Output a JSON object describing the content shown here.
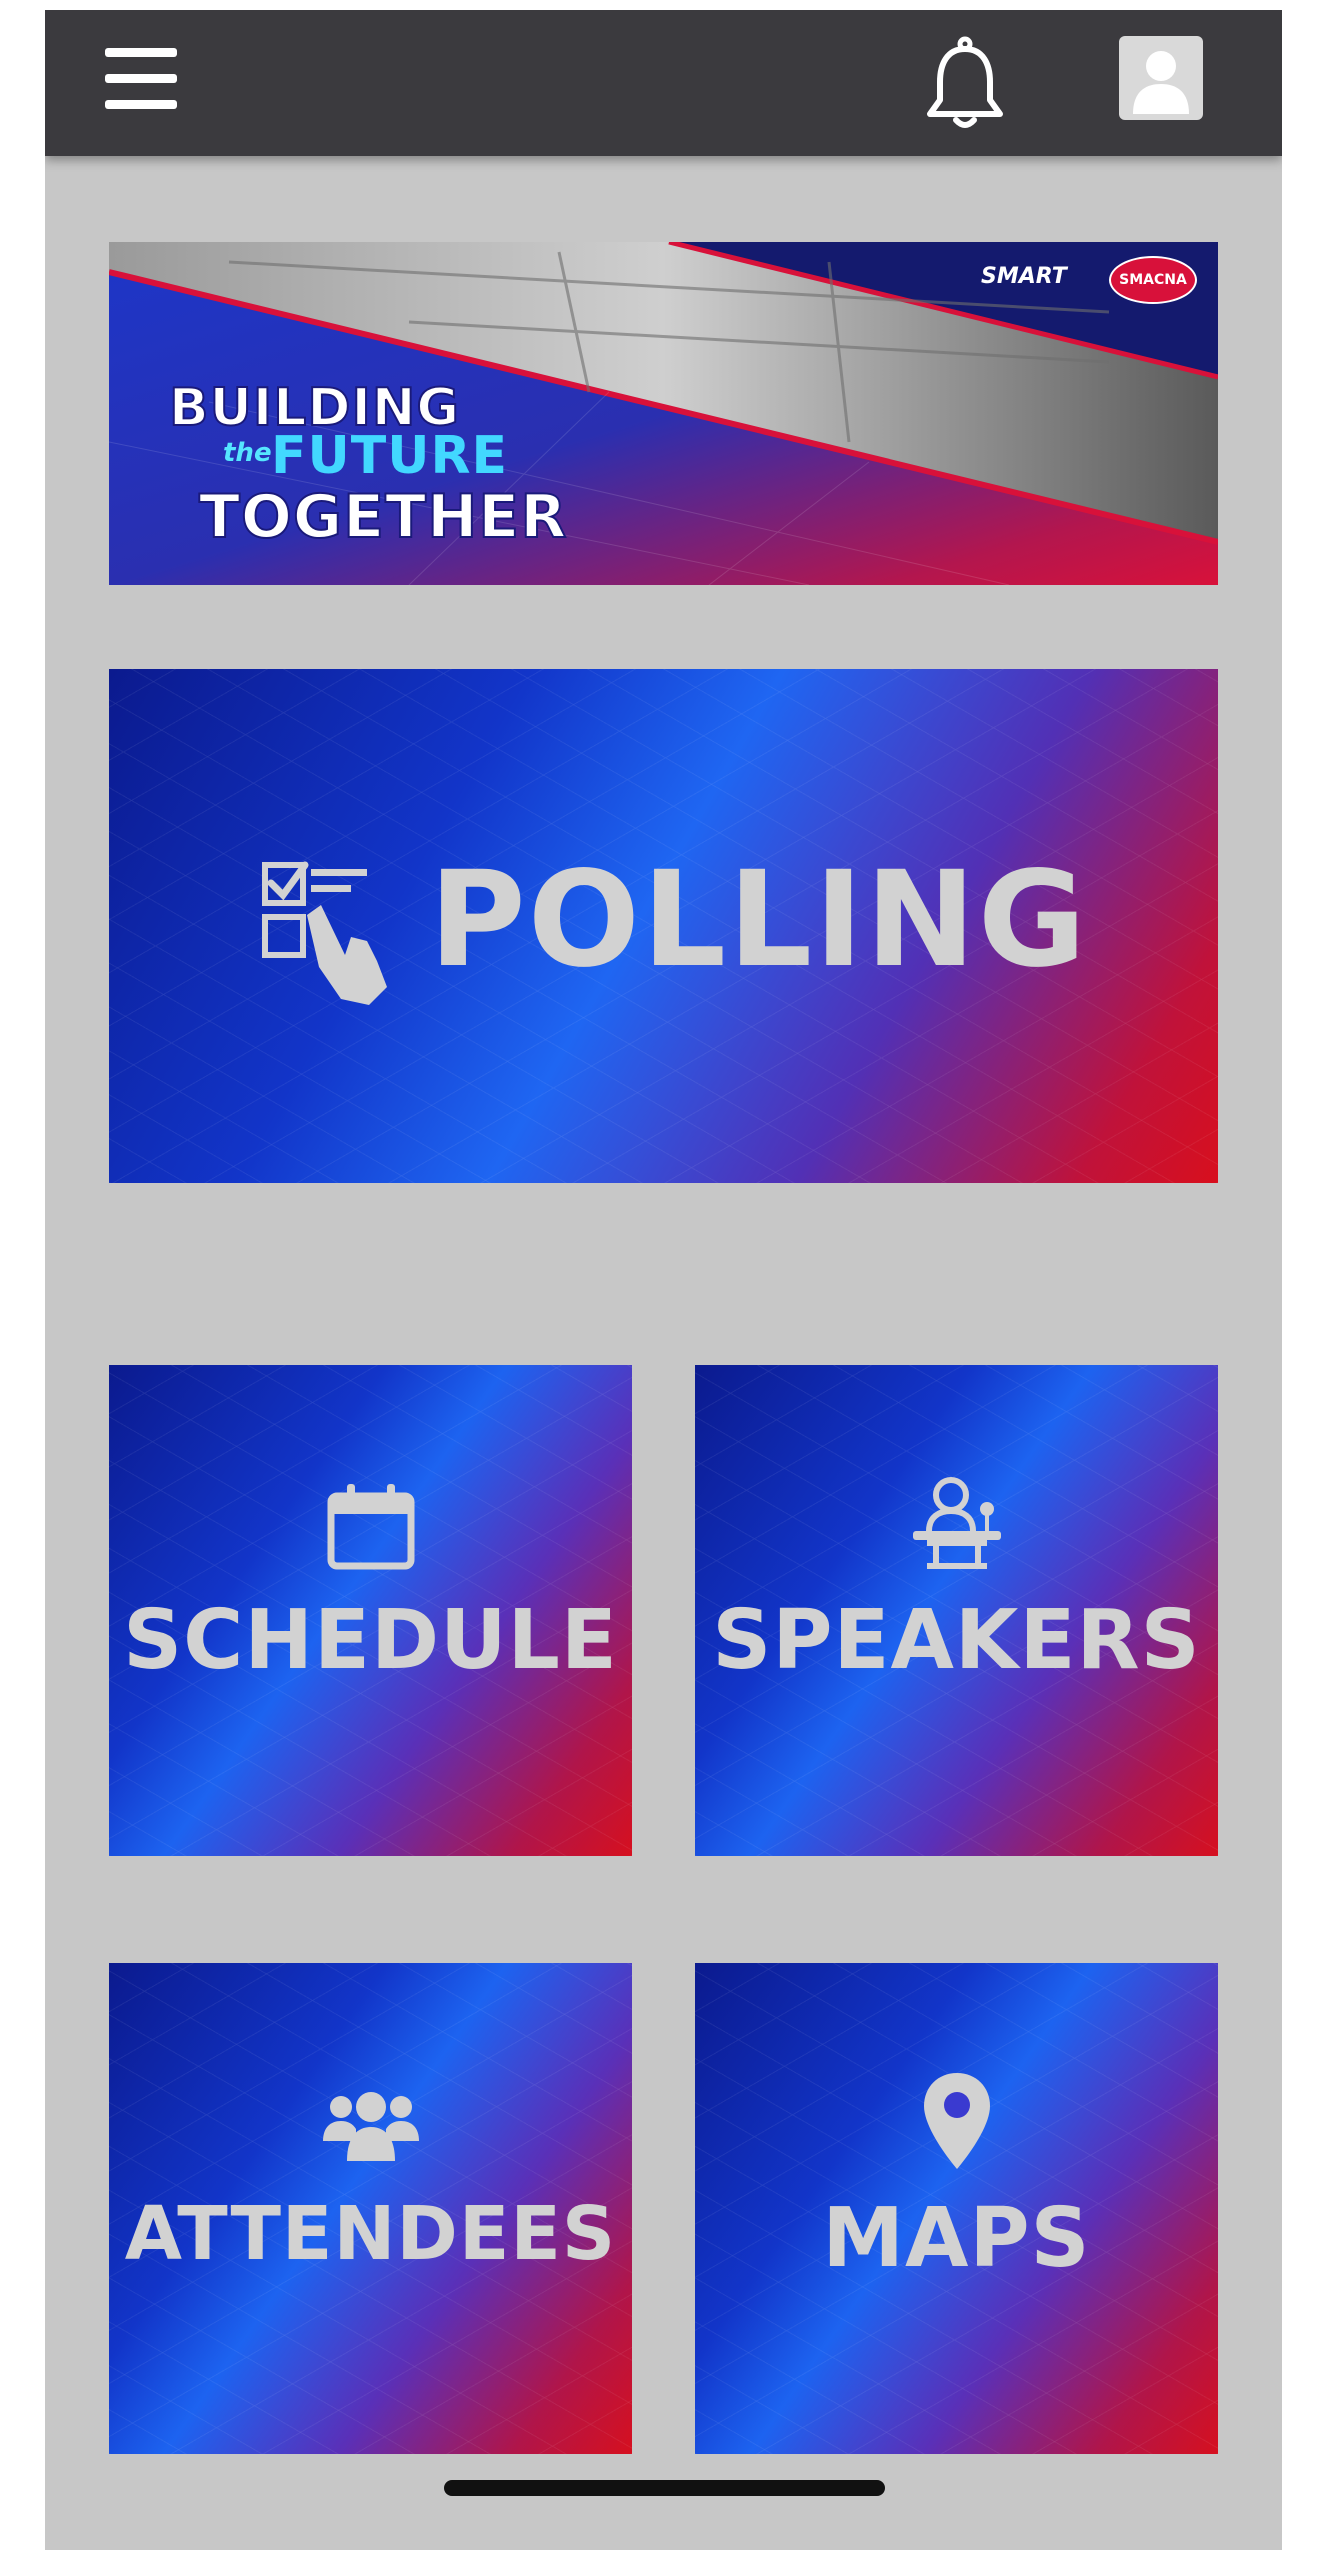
{
  "topbar": {
    "menu_icon": "hamburger-menu-icon",
    "notification_icon": "bell-icon",
    "profile_icon": "user-avatar-icon"
  },
  "banner": {
    "line1": "BUILDING",
    "the": "the",
    "future": "FUTURE",
    "line3": "TOGETHER",
    "logo_smart": "SMART",
    "logo_smacna": "SMACNA"
  },
  "tiles": {
    "polling": {
      "label": "POLLING",
      "icon": "poll-checklist-hand-icon"
    },
    "schedule": {
      "label": "SCHEDULE",
      "icon": "calendar-icon"
    },
    "speakers": {
      "label": "SPEAKERS",
      "icon": "speaker-podium-icon"
    },
    "attendees": {
      "label": "ATTENDEES",
      "icon": "people-group-icon"
    },
    "maps": {
      "label": "MAPS",
      "icon": "map-pin-icon"
    }
  },
  "colors": {
    "topbar": "#3b3a3e",
    "background": "#c7c7c7",
    "tile_blue": "#1235c9",
    "tile_red": "#d6101f",
    "label_gray": "#d2d2d2"
  }
}
